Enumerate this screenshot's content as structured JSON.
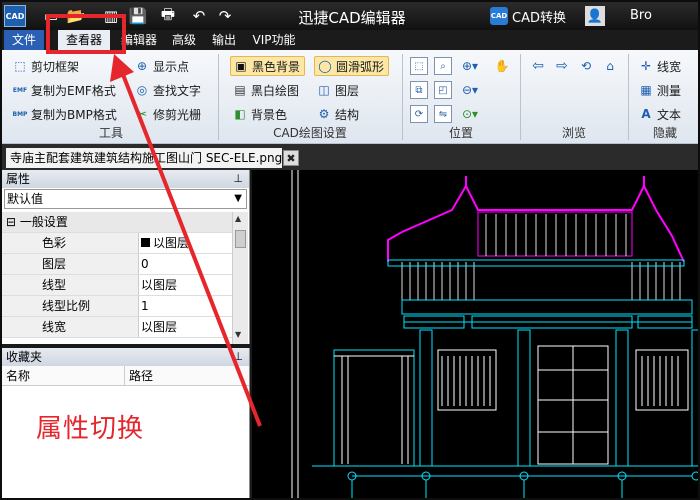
{
  "app": {
    "logo_text": "CAD",
    "title": "迅捷CAD编辑器",
    "cad_convert_label": "CAD转换",
    "cad_convert_icon_text": "CAD",
    "user_name": "Bro"
  },
  "menu_tabs": [
    "文件",
    "查看器",
    "编辑器",
    "高级",
    "输出",
    "VIP功能"
  ],
  "ribbon": {
    "tools": {
      "items": [
        "剪切框架",
        "复制为EMF格式",
        "复制为BMP格式",
        "显示点",
        "查找文字",
        "修剪光栅"
      ],
      "label": "工具",
      "emf_icon_text": "EMF",
      "bmp_icon_text": "BMP"
    },
    "cad_settings": {
      "items": [
        "黑色背景",
        "圆滑弧形",
        "黑白绘图",
        "图层",
        "背景色",
        "结构"
      ],
      "label": "CAD绘图设置"
    },
    "position": {
      "label": "位置"
    },
    "browse": {
      "label": "浏览"
    },
    "hide": {
      "items": [
        "线宽",
        "测量",
        "文本"
      ],
      "label": "隐藏"
    }
  },
  "document": {
    "tab_title": "寺庙主配套建筑建筑结构施工图山门 SEC-ELE.png",
    "close_glyph": "✖"
  },
  "properties": {
    "title": "属性",
    "selector": "默认值",
    "category": "一般设置",
    "rows": [
      {
        "key": "色彩",
        "value": "以图层"
      },
      {
        "key": "图层",
        "value": "0"
      },
      {
        "key": "线型",
        "value": "以图层"
      },
      {
        "key": "线型比例",
        "value": "1"
      },
      {
        "key": "线宽",
        "value": "以图层"
      }
    ]
  },
  "favorites": {
    "title": "收藏夹",
    "columns": [
      "名称",
      "路径"
    ]
  },
  "annotation": {
    "text": "属性切换",
    "color": "#e6262d"
  },
  "colors": {
    "accent_blue": "#2a5fb4",
    "annotation_red": "#e6262d",
    "cad_magenta": "#ff00ff",
    "cad_cyan": "#00e5ff"
  }
}
